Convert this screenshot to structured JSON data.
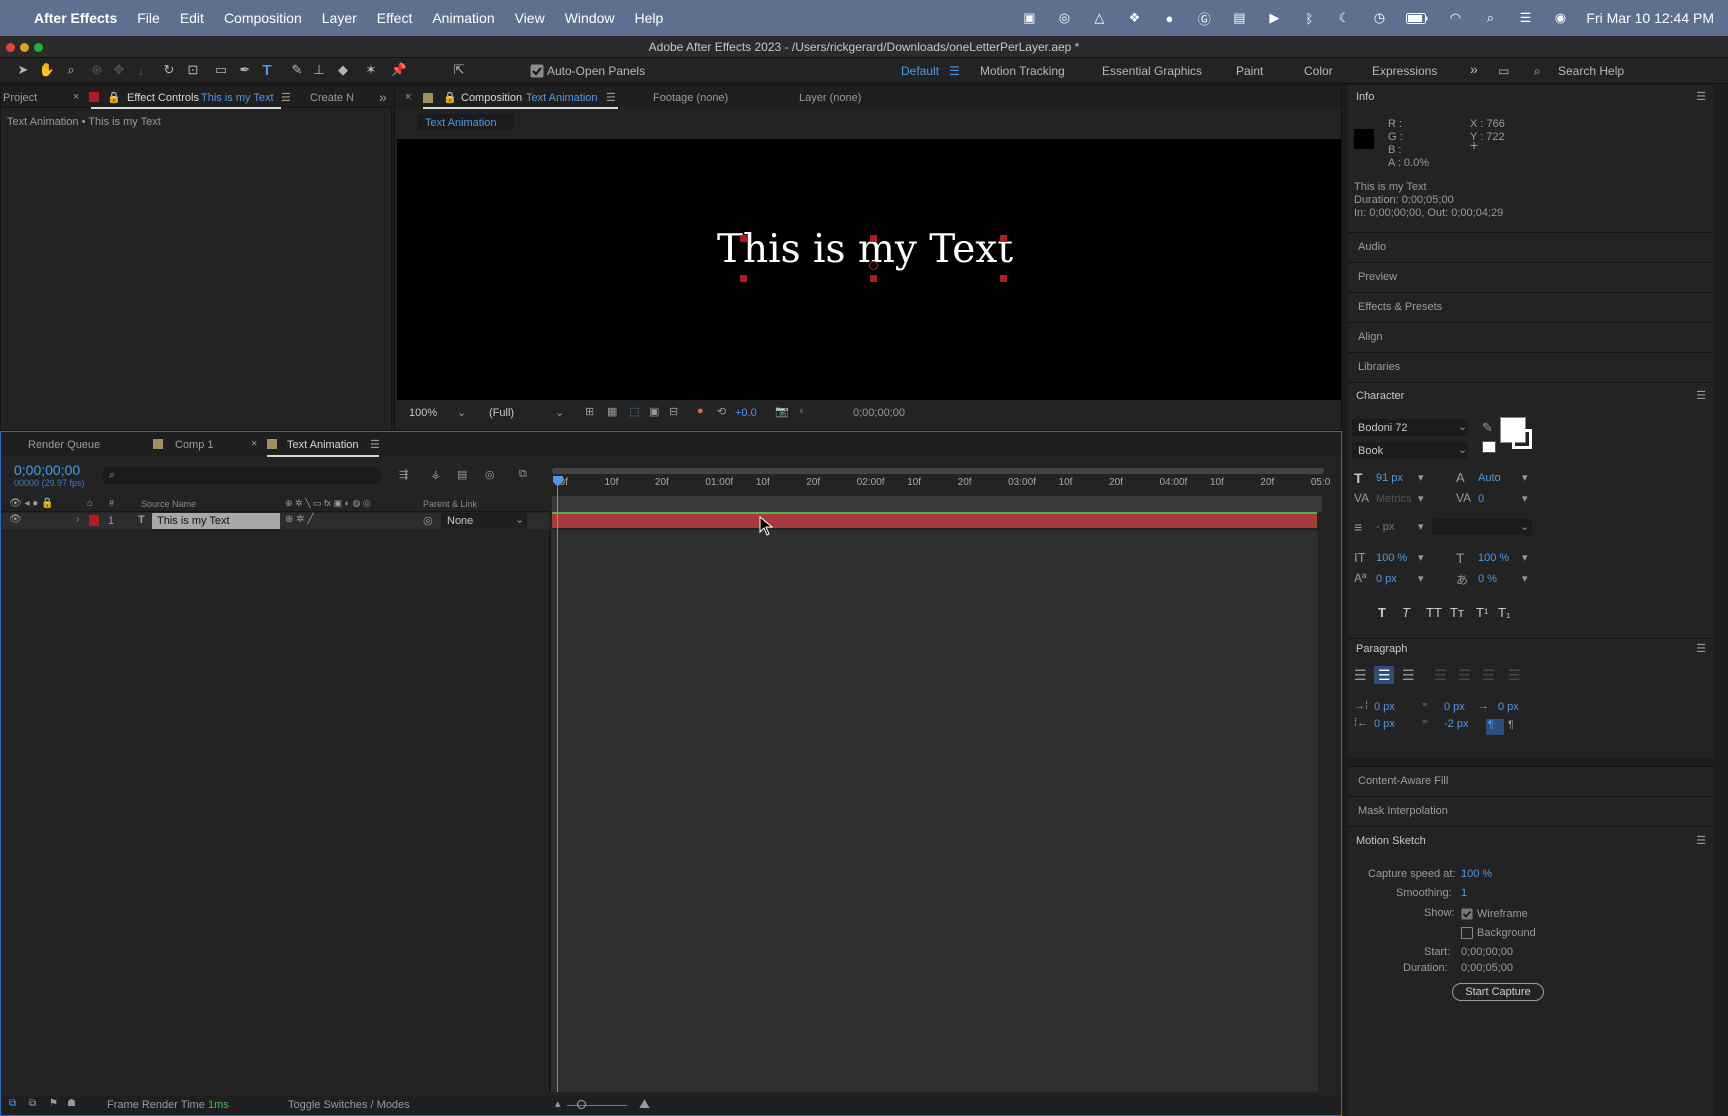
{
  "menubar": {
    "app": "After Effects",
    "items": [
      "File",
      "Edit",
      "Composition",
      "Layer",
      "Effect",
      "Animation",
      "View",
      "Window",
      "Help"
    ],
    "datetime": "Fri Mar 10  12:44 PM"
  },
  "window": {
    "title": "Adobe After Effects 2023 - /Users/rickgerard/Downloads/oneLetterPerLayer.aep *"
  },
  "toolbar": {
    "auto_open": "Auto-Open Panels",
    "workspaces": [
      "Default",
      "Motion Tracking",
      "Essential Graphics",
      "Paint",
      "Color",
      "Expressions"
    ],
    "search": "Search Help"
  },
  "left_panel": {
    "tab_project": "Project",
    "tab_effect_controls": "Effect Controls",
    "tab_effect_controls_target": "This is my Text",
    "tab_create": "Create N",
    "subtitle": "Text Animation • This is my Text"
  },
  "comp_panel": {
    "tab_composition": "Composition",
    "tab_composition_name": "Text Animation",
    "tab_footage": "Footage (none)",
    "tab_layer": "Layer (none)",
    "breadcrumb": "Text Animation",
    "canvas_text": "This is my Text",
    "zoom": "100%",
    "resolution": "(Full)",
    "exposure": "+0.0",
    "timecode": "0;00;00;00"
  },
  "timeline": {
    "tabs": [
      "Render Queue",
      "Comp 1",
      "Text Animation"
    ],
    "timecode": "0;00;00;00",
    "fps": "00000 (29.97 fps)",
    "col_source": "Source Name",
    "col_parent": "Parent & Link",
    "layer_num": "1",
    "layer_name": "This is my Text",
    "layer_parent": "None",
    "ruler": [
      "00f",
      "10f",
      "20f",
      "01:00f",
      "10f",
      "20f",
      "02:00f",
      "10f",
      "20f",
      "03:00f",
      "10f",
      "20f",
      "04:00f",
      "10f",
      "20f",
      "05:0"
    ],
    "frame_render_label": "Frame Render Time",
    "frame_render_value": "1ms",
    "toggle": "Toggle Switches / Modes"
  },
  "info": {
    "title": "Info",
    "r": "R :",
    "g": "G :",
    "b": "B :",
    "a": "A :  0.0%",
    "x": "X : 766",
    "y": "Y : 722",
    "layer": "This is my Text",
    "duration": "Duration: 0;00;05;00",
    "inout": "In: 0;00;00;00, Out: 0;00;04;29"
  },
  "sections": [
    "Audio",
    "Preview",
    "Effects & Presets",
    "Align",
    "Libraries"
  ],
  "character": {
    "title": "Character",
    "font": "Bodoni 72",
    "style": "Book",
    "size": "91 px",
    "leading": "Auto",
    "kerning": "Metrics",
    "tracking": "0",
    "stroke": "- px",
    "vscale": "100 %",
    "hscale": "100 %",
    "baseline": "0 px",
    "tsume": "0 %",
    "styles": [
      "T",
      "T",
      "TT",
      "Tт",
      "T¹",
      "T₁"
    ]
  },
  "paragraph": {
    "title": "Paragraph",
    "indent_left": "0 px",
    "indent_right": "0 px",
    "indent_first": "0 px",
    "space_before": "0 px",
    "space_after": "0 px",
    "space_after2": "-2 px"
  },
  "sections2": [
    "Content-Aware Fill",
    "Mask Interpolation"
  ],
  "motion_sketch": {
    "title": "Motion Sketch",
    "capture_label": "Capture speed at:",
    "capture_value": "100 %",
    "smoothing_label": "Smoothing:",
    "smoothing_value": "1",
    "show_label": "Show:",
    "wireframe": "Wireframe",
    "background": "Background",
    "start_label": "Start:",
    "start_value": "0;00;00;00",
    "duration_label": "Duration:",
    "duration_value": "0;00;05;00",
    "button": "Start Capture"
  }
}
